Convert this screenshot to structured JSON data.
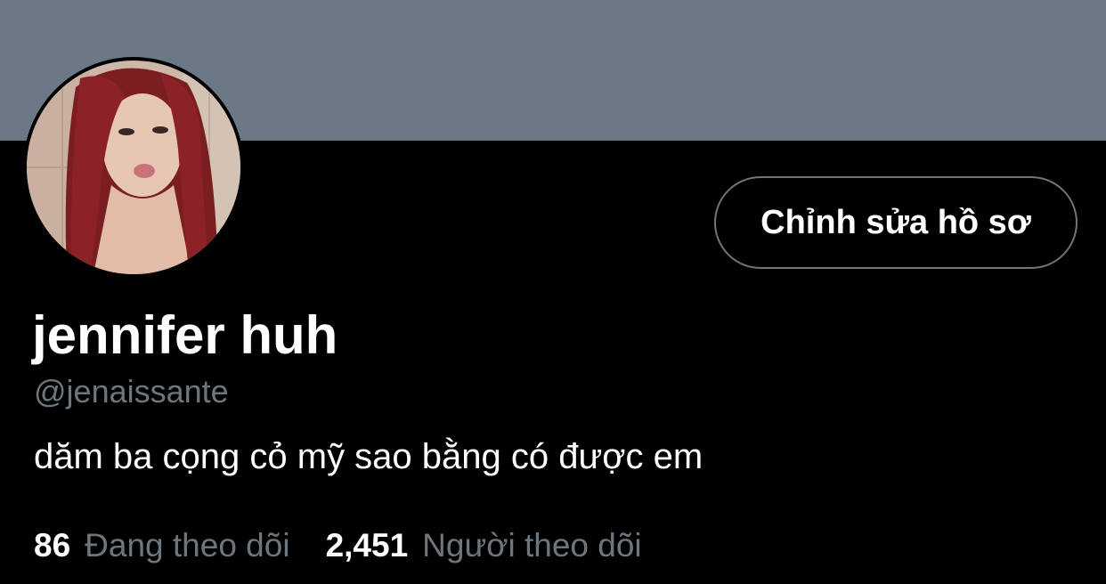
{
  "profile": {
    "banner_color": "#6b7987",
    "avatar": {
      "icon": "profile-photo"
    },
    "edit_button_label": "Chỉnh sửa hồ sơ",
    "display_name": "jennifer huh",
    "handle": "@jenaissante",
    "bio": "dăm ba cọng cỏ mỹ sao bằng có được em",
    "stats": {
      "following_count": "86",
      "following_label": "Đang theo dõi",
      "followers_count": "2,451",
      "followers_label": "Người theo dõi"
    }
  },
  "colors": {
    "background": "#000000",
    "text_primary": "#ffffff",
    "text_secondary": "#6e767d",
    "button_border": "#6e767d"
  }
}
